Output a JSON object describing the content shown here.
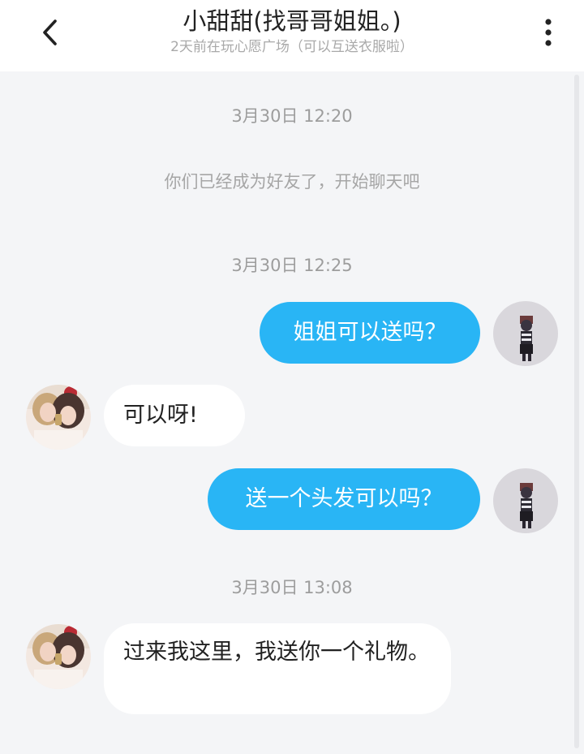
{
  "header": {
    "title": "小甜甜(找哥哥姐姐。)",
    "subtitle": "2天前在玩心愿广场（可以互送衣服啦）",
    "back_icon": "chevron-left-icon",
    "more_icon": "more-vertical-icon"
  },
  "chat": {
    "timestamps": [
      "3月30日 12:20",
      "3月30日 12:25",
      "3月30日 13:08"
    ],
    "system_message": "你们已经成为好友了，开始聊天吧",
    "messages": [
      {
        "from": "me",
        "text": "姐姐可以送吗？"
      },
      {
        "from": "friend",
        "text": "可以呀!"
      },
      {
        "from": "me",
        "text": "送一个头发可以吗？"
      },
      {
        "from": "friend",
        "text": "过来我这里，我送你一个礼物。"
      }
    ]
  },
  "colors": {
    "outgoing_bubble": "#29b5f5",
    "incoming_bubble": "#ffffff",
    "background": "#f4f5f7"
  }
}
